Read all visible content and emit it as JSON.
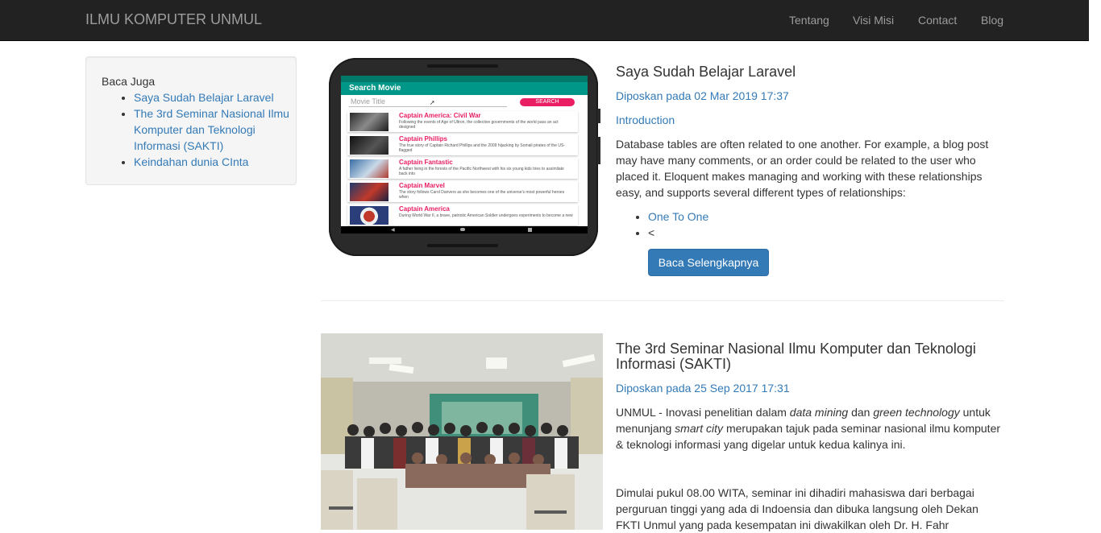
{
  "navbar": {
    "brand": "ILMU KOMPUTER UNMUL",
    "links": [
      "Tentang",
      "Visi Misi",
      "Contact",
      "Blog"
    ]
  },
  "sidebar": {
    "title": "Baca Juga",
    "items": [
      "Saya Sudah Belajar Laravel",
      "The 3rd Seminar Nasional Ilmu Komputer dan Teknologi Informasi (SAKTI)",
      "Keindahan dunia CInta"
    ]
  },
  "posts": [
    {
      "title": "Saya Sudah Belajar Laravel",
      "date": "Diposkan pada 02 Mar 2019 17:37",
      "intro": "Introduction",
      "body": "Database tables are often related to one another. For example, a blog post may have many comments, or an order could be related to the user who placed it. Eloquent makes managing and working with these relationships easy, and supports several different types of relationships:",
      "list": [
        "One To One",
        "<"
      ],
      "button": "Baca Selengkapnya",
      "mockup": {
        "app_title": "Search Movie",
        "search_placeholder": "Movie Title",
        "search_button": "SEARCH",
        "movies": [
          {
            "title": "Captain America: Civil War",
            "desc": "Following the events of Age of Ultron, the collective governments of the world pass an act designed"
          },
          {
            "title": "Captain Phillips",
            "desc": "The true story of Captain Richard Phillips and the 2009 hijacking by Somali pirates of the US-flagged"
          },
          {
            "title": "Captain Fantastic",
            "desc": "A father living in the forests of the Pacific Northwest with his six young kids tries to assimilate back into"
          },
          {
            "title": "Captain Marvel",
            "desc": "The story follows Carol Danvers as she becomes one of the universe's most powerful heroes when"
          },
          {
            "title": "Captain America",
            "desc": "During World War II, a brave, patriotic American Soldier undergoes experiments to become a new"
          }
        ]
      }
    },
    {
      "title": "The 3rd Seminar Nasional Ilmu Komputer dan Teknologi Informasi (SAKTI)",
      "date": "Diposkan pada 25 Sep 2017 17:31",
      "p1_a": "UNMUL - Inovasi penelitian dalam ",
      "p1_em1": "data mining",
      "p1_b": " dan ",
      "p1_em2": "green technology",
      "p1_c": " untuk menunjang ",
      "p1_em3": "smart city",
      "p1_d": " merupakan tajuk pada seminar nasional ilmu komputer & teknologi informasi yang digelar untuk kedua kalinya ini.",
      "p2": "Dimulai pukul 08.00 WITA, seminar ini dihadiri mahasiswa dari berbagai perguruan tinggi yang ada di Indoensia dan dibuka langsung oleh Dekan FKTI Unmul yang pada kesempatan ini diwakilkan oleh Dr. H. Fahr"
    }
  ]
}
